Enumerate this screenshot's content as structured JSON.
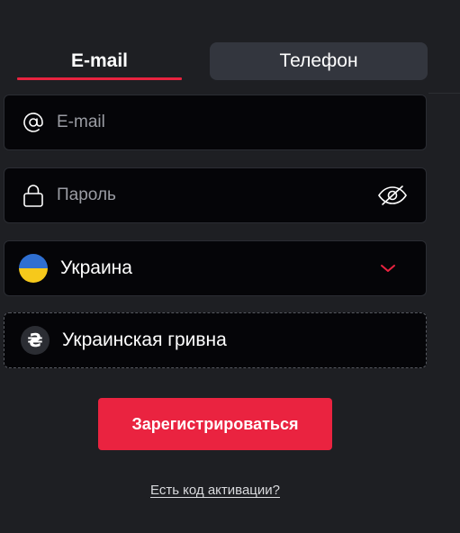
{
  "tabs": {
    "email_label": "E-mail",
    "phone_label": "Телефон",
    "active": "email"
  },
  "form": {
    "email": {
      "placeholder": "E-mail",
      "value": "",
      "icon": "at-icon"
    },
    "password": {
      "placeholder": "Пароль",
      "value": "",
      "icon": "lock-icon",
      "toggle_icon": "eye-slash-icon"
    },
    "country": {
      "value": "Украина",
      "flag_icon": "ukraine-flag-icon",
      "dropdown_icon": "chevron-down-icon"
    },
    "currency": {
      "value": "Украинская гривна",
      "symbol": "₴",
      "icon": "hryvnia-icon"
    }
  },
  "actions": {
    "register_label": "Зарегистрироваться",
    "activation_link": "Есть код активации?"
  },
  "colors": {
    "background": "#1e1f23",
    "field_background": "#050508",
    "accent": "#ea2340",
    "inactive_tab": "#33363e"
  }
}
